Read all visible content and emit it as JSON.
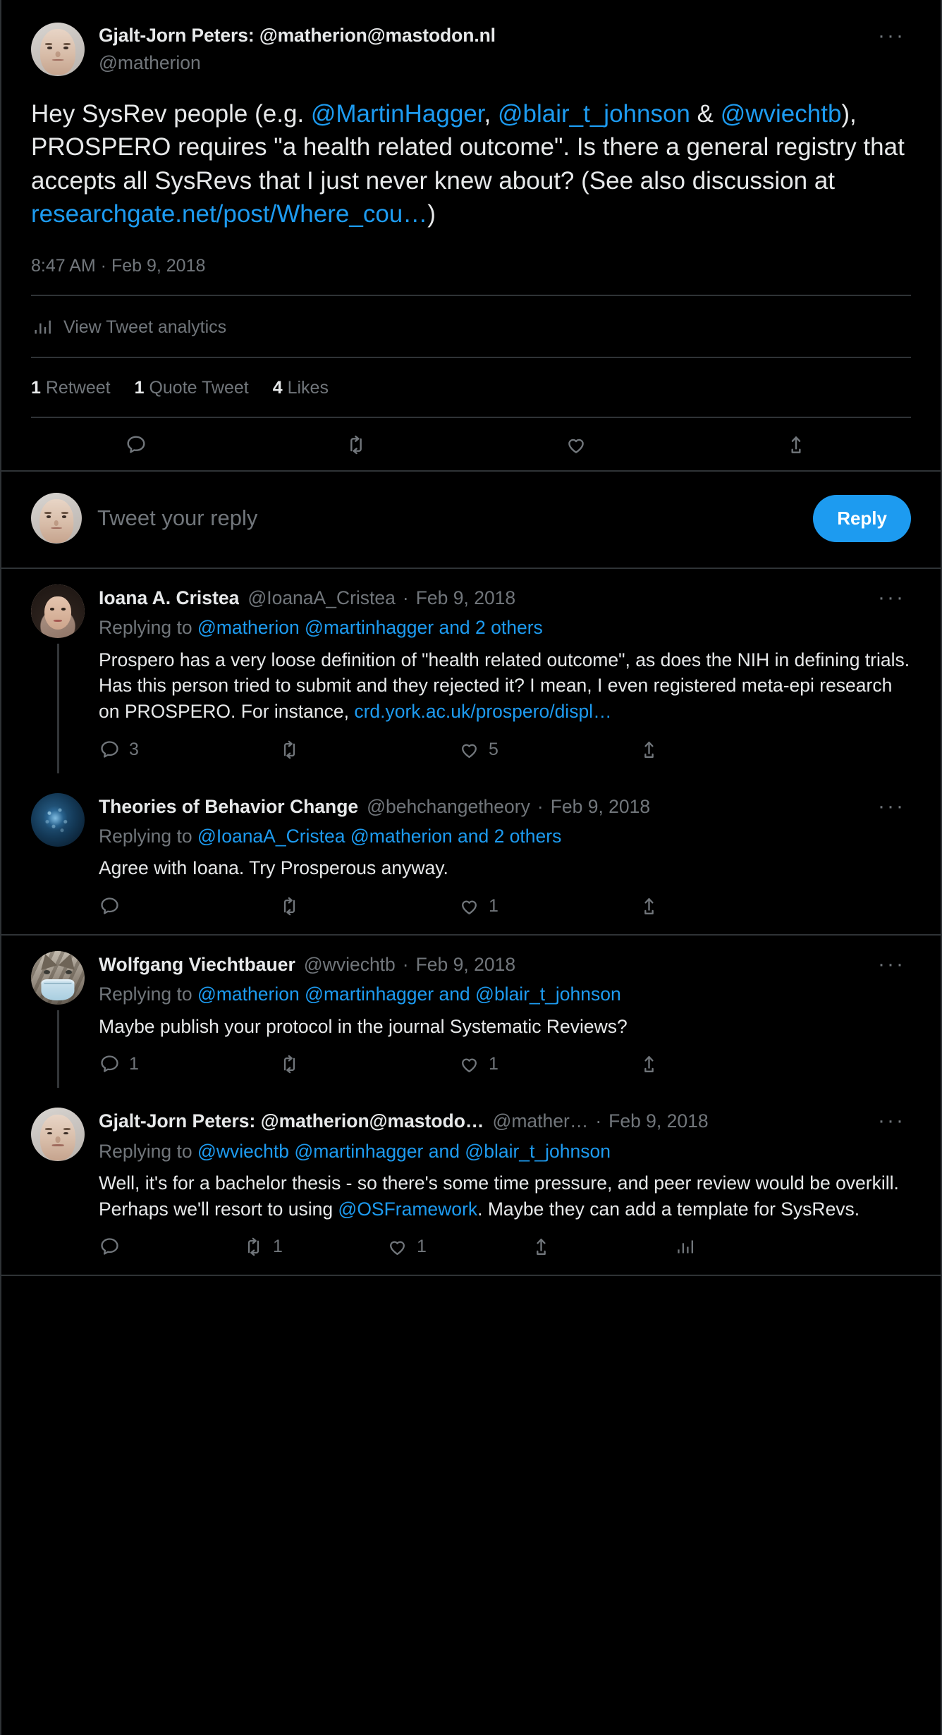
{
  "focal_tweet": {
    "display_name": "Gjalt-Jorn Peters: @matherion@mastodon.nl",
    "handle": "@matherion",
    "more_label": "···",
    "body": {
      "seg1": "Hey SysRev people (e.g. ",
      "mention1": "@MartinHagger",
      "seg2": ", ",
      "mention2": "@blair_t_johnson",
      "seg3": " & ",
      "mention3": "@wviechtb",
      "seg4": "), PROSPERO requires \"a health related outcome\". Is there a general registry that accepts all SysRevs that I just never knew about? (See also discussion at ",
      "link1": "researchgate.net/post/Where_cou…",
      "seg5": ")"
    },
    "timestamp": "8:47 AM · Feb 9, 2018",
    "analytics_label": "View Tweet analytics",
    "stats": [
      {
        "count": "1",
        "label": "Retweet"
      },
      {
        "count": "1",
        "label": "Quote Tweet"
      },
      {
        "count": "4",
        "label": "Likes"
      }
    ],
    "actions": [
      {
        "icon": "reply-icon",
        "count": ""
      },
      {
        "icon": "retweet-icon",
        "count": ""
      },
      {
        "icon": "like-icon",
        "count": ""
      },
      {
        "icon": "share-icon",
        "count": ""
      }
    ]
  },
  "composer": {
    "placeholder": "Tweet your reply",
    "reply_button": "Reply"
  },
  "threads": [
    {
      "replies": [
        {
          "display_name": "Ioana A. Cristea",
          "handle": "@IoanaA_Cristea",
          "separator": "·",
          "date": "Feb 9, 2018",
          "more_label": "···",
          "replying_to_prefix": "Replying to ",
          "replying_to_mentions": "@matherion @martinhagger and 2 others",
          "text_seg1": "Prospero has a very loose definition of \"health related outcome\", as does the NIH in defining trials. Has this person tried to submit and they rejected it? I mean, I even registered meta-epi research on PROSPERO. For instance, ",
          "text_link": "crd.york.ac.uk/prospero/displ…",
          "text_seg2": "",
          "actions": [
            {
              "icon": "reply-icon",
              "count": "3"
            },
            {
              "icon": "retweet-icon",
              "count": ""
            },
            {
              "icon": "like-icon",
              "count": "5"
            },
            {
              "icon": "share-icon",
              "count": ""
            }
          ],
          "has_thread_line": true,
          "avatar": "ioana"
        },
        {
          "display_name": "Theories of Behavior Change",
          "handle": "@behchangetheory",
          "separator": "·",
          "date": "Feb 9, 2018",
          "more_label": "···",
          "replying_to_prefix": "Replying to ",
          "replying_to_mentions": "@IoanaA_Cristea @matherion and 2 others",
          "text_seg1": "Agree with Ioana. Try Prosperous anyway.",
          "text_link": "",
          "text_seg2": "",
          "actions": [
            {
              "icon": "reply-icon",
              "count": ""
            },
            {
              "icon": "retweet-icon",
              "count": ""
            },
            {
              "icon": "like-icon",
              "count": "1"
            },
            {
              "icon": "share-icon",
              "count": ""
            }
          ],
          "has_thread_line": false,
          "avatar": "brain"
        }
      ]
    },
    {
      "replies": [
        {
          "display_name": "Wolfgang Viechtbauer",
          "handle": "@wviechtb",
          "separator": "·",
          "date": "Feb 9, 2018",
          "more_label": "···",
          "replying_to_prefix": "Replying to ",
          "replying_to_mentions": "@matherion @martinhagger and @blair_t_johnson",
          "text_seg1": "Maybe publish your protocol in the journal Systematic Reviews?",
          "text_link": "",
          "text_seg2": "",
          "actions": [
            {
              "icon": "reply-icon",
              "count": "1"
            },
            {
              "icon": "retweet-icon",
              "count": ""
            },
            {
              "icon": "like-icon",
              "count": "1"
            },
            {
              "icon": "share-icon",
              "count": ""
            }
          ],
          "has_thread_line": true,
          "avatar": "face"
        },
        {
          "display_name": "Gjalt-Jorn Peters: @matherion@mastodo…",
          "handle": "@mather…",
          "separator": "·",
          "date": "Feb 9, 2018",
          "more_label": "···",
          "replying_to_prefix": "Replying to ",
          "replying_to_mentions": "@wviechtb @martinhagger and @blair_t_johnson",
          "text_seg1": "Well, it's for a bachelor thesis - so there's some time pressure, and peer review would be overkill. Perhaps we'll resort to using ",
          "text_link": "@OSFramework",
          "text_seg2": ". Maybe they can add a template for SysRevs.",
          "actions": [
            {
              "icon": "reply-icon",
              "count": ""
            },
            {
              "icon": "retweet-icon",
              "count": "1"
            },
            {
              "icon": "like-icon",
              "count": "1"
            },
            {
              "icon": "share-icon",
              "count": ""
            },
            {
              "icon": "analytics-icon",
              "count": ""
            }
          ],
          "has_thread_line": false,
          "avatar": "face"
        }
      ]
    }
  ],
  "colors": {
    "background": "#000000",
    "accent": "#1d9bf0",
    "text": "#e7e9ea",
    "muted": "#71767b",
    "border": "#2f3336"
  }
}
